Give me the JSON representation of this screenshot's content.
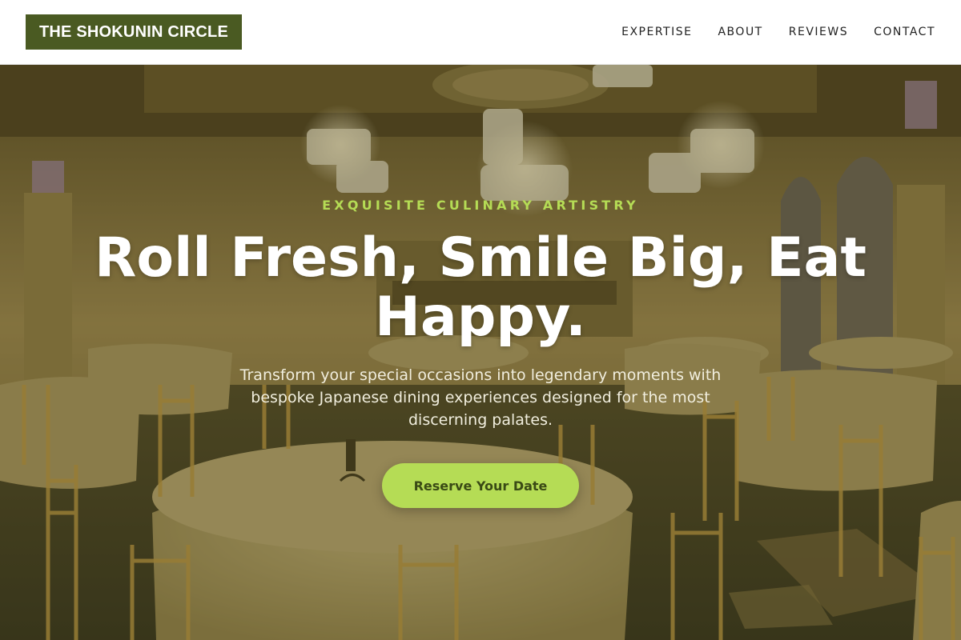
{
  "header": {
    "logo_text": "THE SHOKUNIN CIRCLE",
    "nav": [
      "EXPERTISE",
      "ABOUT",
      "REVIEWS",
      "CONTACT"
    ]
  },
  "hero": {
    "eyebrow": "EXQUISITE CULINARY ARTISTRY",
    "headline": "Roll Fresh, Smile Big, Eat Happy.",
    "subtitle": "Transform your special occasions into legendary moments with bespoke Japanese dining experiences designed for the most discerning palates.",
    "cta_label": "Reserve Your Date",
    "background_image": "banquet hall with round tables, gold chairs and crystal chandeliers"
  },
  "colors": {
    "brand_green": "#4a5a22",
    "accent_lime": "#b5dc55",
    "header_bg": "#ffffff"
  }
}
